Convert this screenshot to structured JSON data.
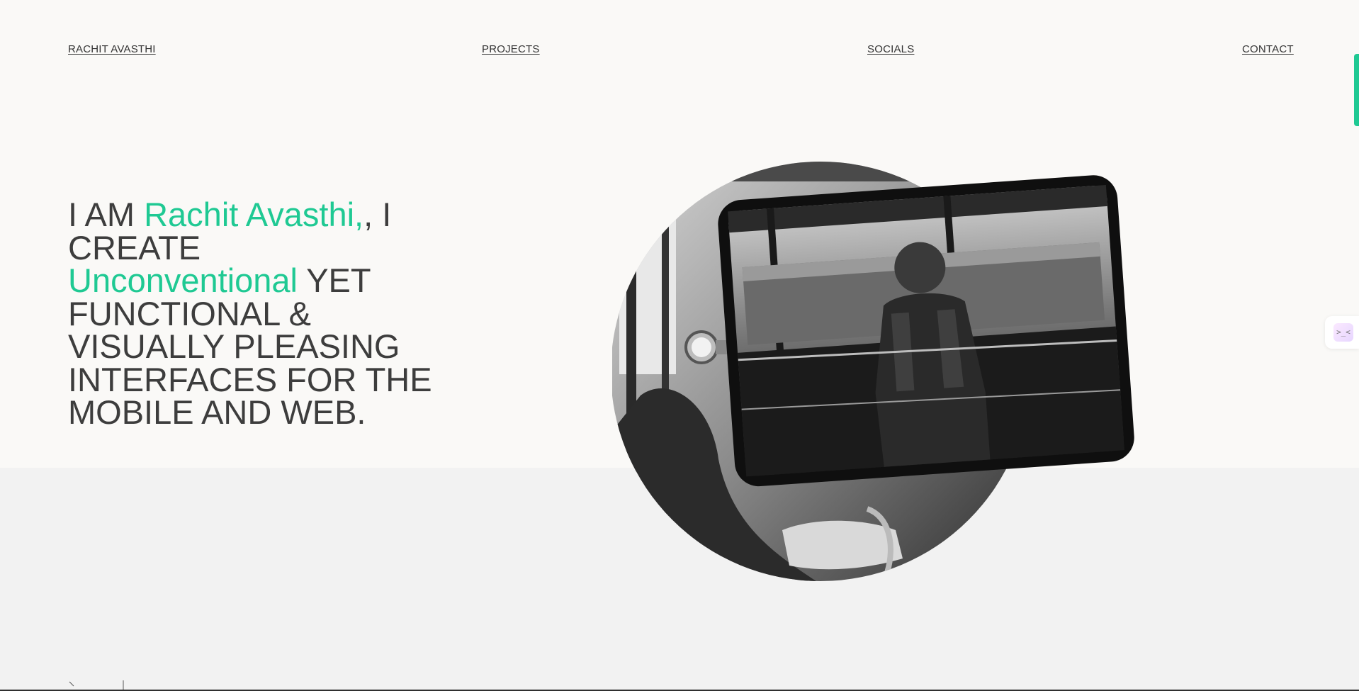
{
  "nav": {
    "home": "RACHIT AVASTHI",
    "projects": "PROJECTS",
    "socials": "SOCIALS",
    "contact": "CONTACT"
  },
  "hero": {
    "part1": "I AM ",
    "name": "Rachit Avasthi,",
    "part2": ", I CREATE ",
    "accent_word": "Unconventional",
    "part3": " YET FUNCTIONAL & VISUALLY PLEASING INTERFACES FOR THE MOBILE AND WEB."
  },
  "side_widget": {
    "glyph": ">_<"
  },
  "colors": {
    "accent": "#1fc993",
    "background": "#faf9f7",
    "text": "#3d3d3d"
  },
  "icons": {
    "scroll_indicator": "scroll-progress-bar",
    "side_widget": "chat-widget-icon",
    "corner": "chevron-right-icon"
  }
}
